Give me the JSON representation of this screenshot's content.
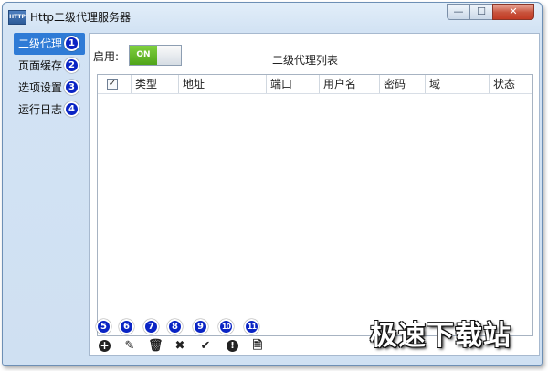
{
  "window": {
    "title": "Http二级代理服务器",
    "app_icon_text": "HTTP",
    "minimize_symbol": "—",
    "maximize_symbol": "☐",
    "close_symbol": "✕"
  },
  "sidebar": {
    "items": [
      {
        "label": "二级代理",
        "badge": "1",
        "active": true
      },
      {
        "label": "页面缓存",
        "badge": "2",
        "active": false
      },
      {
        "label": "选项设置",
        "badge": "3",
        "active": false
      },
      {
        "label": "运行日志",
        "badge": "4",
        "active": false
      }
    ]
  },
  "main": {
    "enable_label": "启用:",
    "toggle_text": "ON",
    "list_title": "二级代理列表",
    "table": {
      "columns": [
        "类型",
        "地址",
        "端口",
        "用户名",
        "密码",
        "域",
        "状态"
      ],
      "select_all_checked": true,
      "rows": []
    }
  },
  "toolbar": {
    "badges": [
      "5",
      "6",
      "7",
      "8",
      "9",
      "10",
      "11"
    ],
    "icons": [
      "add-icon",
      "edit-icon",
      "delete-icon",
      "remove-icon",
      "check-icon",
      "warning-icon",
      "document-icon"
    ]
  },
  "watermark": "极速下载站",
  "colors": {
    "accent": "#2f7bd6",
    "badge": "#0a24c4",
    "toggle_on": "#5db226",
    "close_button": "#c8523b"
  }
}
